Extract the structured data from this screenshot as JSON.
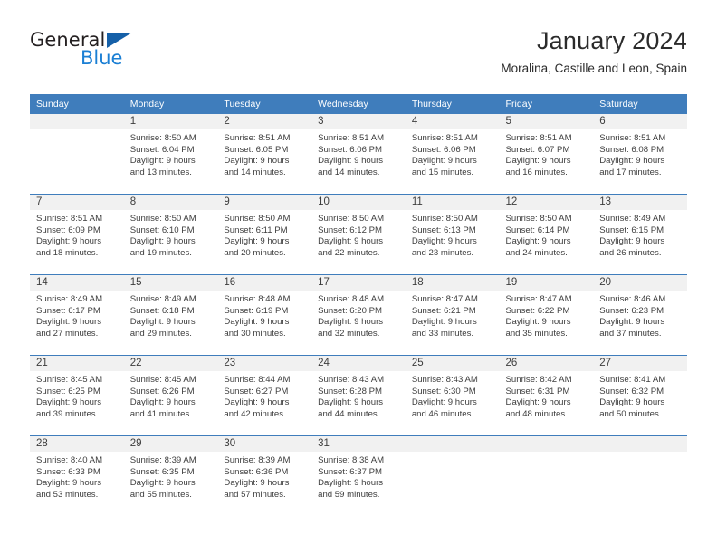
{
  "brand": {
    "name_part1": "General",
    "name_part2": "Blue",
    "triangle_color": "#1560a8",
    "blue_color": "#1b7fd4"
  },
  "header": {
    "title": "January 2024",
    "subtitle": "Moralina, Castille and Leon, Spain"
  },
  "theme": {
    "header_bg": "#3f7dbc",
    "daynum_bg": "#f1f1f1",
    "rule_color": "#3f7dbc",
    "text_color": "#3d3d3d"
  },
  "weekday_headers": [
    "Sunday",
    "Monday",
    "Tuesday",
    "Wednesday",
    "Thursday",
    "Friday",
    "Saturday"
  ],
  "weeks": [
    [
      {
        "day": "",
        "sunrise": "",
        "sunset": "",
        "daylight_line1": "",
        "daylight_line2": ""
      },
      {
        "day": "1",
        "sunrise": "Sunrise: 8:50 AM",
        "sunset": "Sunset: 6:04 PM",
        "daylight_line1": "Daylight: 9 hours",
        "daylight_line2": "and 13 minutes."
      },
      {
        "day": "2",
        "sunrise": "Sunrise: 8:51 AM",
        "sunset": "Sunset: 6:05 PM",
        "daylight_line1": "Daylight: 9 hours",
        "daylight_line2": "and 14 minutes."
      },
      {
        "day": "3",
        "sunrise": "Sunrise: 8:51 AM",
        "sunset": "Sunset: 6:06 PM",
        "daylight_line1": "Daylight: 9 hours",
        "daylight_line2": "and 14 minutes."
      },
      {
        "day": "4",
        "sunrise": "Sunrise: 8:51 AM",
        "sunset": "Sunset: 6:06 PM",
        "daylight_line1": "Daylight: 9 hours",
        "daylight_line2": "and 15 minutes."
      },
      {
        "day": "5",
        "sunrise": "Sunrise: 8:51 AM",
        "sunset": "Sunset: 6:07 PM",
        "daylight_line1": "Daylight: 9 hours",
        "daylight_line2": "and 16 minutes."
      },
      {
        "day": "6",
        "sunrise": "Sunrise: 8:51 AM",
        "sunset": "Sunset: 6:08 PM",
        "daylight_line1": "Daylight: 9 hours",
        "daylight_line2": "and 17 minutes."
      }
    ],
    [
      {
        "day": "7",
        "sunrise": "Sunrise: 8:51 AM",
        "sunset": "Sunset: 6:09 PM",
        "daylight_line1": "Daylight: 9 hours",
        "daylight_line2": "and 18 minutes."
      },
      {
        "day": "8",
        "sunrise": "Sunrise: 8:50 AM",
        "sunset": "Sunset: 6:10 PM",
        "daylight_line1": "Daylight: 9 hours",
        "daylight_line2": "and 19 minutes."
      },
      {
        "day": "9",
        "sunrise": "Sunrise: 8:50 AM",
        "sunset": "Sunset: 6:11 PM",
        "daylight_line1": "Daylight: 9 hours",
        "daylight_line2": "and 20 minutes."
      },
      {
        "day": "10",
        "sunrise": "Sunrise: 8:50 AM",
        "sunset": "Sunset: 6:12 PM",
        "daylight_line1": "Daylight: 9 hours",
        "daylight_line2": "and 22 minutes."
      },
      {
        "day": "11",
        "sunrise": "Sunrise: 8:50 AM",
        "sunset": "Sunset: 6:13 PM",
        "daylight_line1": "Daylight: 9 hours",
        "daylight_line2": "and 23 minutes."
      },
      {
        "day": "12",
        "sunrise": "Sunrise: 8:50 AM",
        "sunset": "Sunset: 6:14 PM",
        "daylight_line1": "Daylight: 9 hours",
        "daylight_line2": "and 24 minutes."
      },
      {
        "day": "13",
        "sunrise": "Sunrise: 8:49 AM",
        "sunset": "Sunset: 6:15 PM",
        "daylight_line1": "Daylight: 9 hours",
        "daylight_line2": "and 26 minutes."
      }
    ],
    [
      {
        "day": "14",
        "sunrise": "Sunrise: 8:49 AM",
        "sunset": "Sunset: 6:17 PM",
        "daylight_line1": "Daylight: 9 hours",
        "daylight_line2": "and 27 minutes."
      },
      {
        "day": "15",
        "sunrise": "Sunrise: 8:49 AM",
        "sunset": "Sunset: 6:18 PM",
        "daylight_line1": "Daylight: 9 hours",
        "daylight_line2": "and 29 minutes."
      },
      {
        "day": "16",
        "sunrise": "Sunrise: 8:48 AM",
        "sunset": "Sunset: 6:19 PM",
        "daylight_line1": "Daylight: 9 hours",
        "daylight_line2": "and 30 minutes."
      },
      {
        "day": "17",
        "sunrise": "Sunrise: 8:48 AM",
        "sunset": "Sunset: 6:20 PM",
        "daylight_line1": "Daylight: 9 hours",
        "daylight_line2": "and 32 minutes."
      },
      {
        "day": "18",
        "sunrise": "Sunrise: 8:47 AM",
        "sunset": "Sunset: 6:21 PM",
        "daylight_line1": "Daylight: 9 hours",
        "daylight_line2": "and 33 minutes."
      },
      {
        "day": "19",
        "sunrise": "Sunrise: 8:47 AM",
        "sunset": "Sunset: 6:22 PM",
        "daylight_line1": "Daylight: 9 hours",
        "daylight_line2": "and 35 minutes."
      },
      {
        "day": "20",
        "sunrise": "Sunrise: 8:46 AM",
        "sunset": "Sunset: 6:23 PM",
        "daylight_line1": "Daylight: 9 hours",
        "daylight_line2": "and 37 minutes."
      }
    ],
    [
      {
        "day": "21",
        "sunrise": "Sunrise: 8:45 AM",
        "sunset": "Sunset: 6:25 PM",
        "daylight_line1": "Daylight: 9 hours",
        "daylight_line2": "and 39 minutes."
      },
      {
        "day": "22",
        "sunrise": "Sunrise: 8:45 AM",
        "sunset": "Sunset: 6:26 PM",
        "daylight_line1": "Daylight: 9 hours",
        "daylight_line2": "and 41 minutes."
      },
      {
        "day": "23",
        "sunrise": "Sunrise: 8:44 AM",
        "sunset": "Sunset: 6:27 PM",
        "daylight_line1": "Daylight: 9 hours",
        "daylight_line2": "and 42 minutes."
      },
      {
        "day": "24",
        "sunrise": "Sunrise: 8:43 AM",
        "sunset": "Sunset: 6:28 PM",
        "daylight_line1": "Daylight: 9 hours",
        "daylight_line2": "and 44 minutes."
      },
      {
        "day": "25",
        "sunrise": "Sunrise: 8:43 AM",
        "sunset": "Sunset: 6:30 PM",
        "daylight_line1": "Daylight: 9 hours",
        "daylight_line2": "and 46 minutes."
      },
      {
        "day": "26",
        "sunrise": "Sunrise: 8:42 AM",
        "sunset": "Sunset: 6:31 PM",
        "daylight_line1": "Daylight: 9 hours",
        "daylight_line2": "and 48 minutes."
      },
      {
        "day": "27",
        "sunrise": "Sunrise: 8:41 AM",
        "sunset": "Sunset: 6:32 PM",
        "daylight_line1": "Daylight: 9 hours",
        "daylight_line2": "and 50 minutes."
      }
    ],
    [
      {
        "day": "28",
        "sunrise": "Sunrise: 8:40 AM",
        "sunset": "Sunset: 6:33 PM",
        "daylight_line1": "Daylight: 9 hours",
        "daylight_line2": "and 53 minutes."
      },
      {
        "day": "29",
        "sunrise": "Sunrise: 8:39 AM",
        "sunset": "Sunset: 6:35 PM",
        "daylight_line1": "Daylight: 9 hours",
        "daylight_line2": "and 55 minutes."
      },
      {
        "day": "30",
        "sunrise": "Sunrise: 8:39 AM",
        "sunset": "Sunset: 6:36 PM",
        "daylight_line1": "Daylight: 9 hours",
        "daylight_line2": "and 57 minutes."
      },
      {
        "day": "31",
        "sunrise": "Sunrise: 8:38 AM",
        "sunset": "Sunset: 6:37 PM",
        "daylight_line1": "Daylight: 9 hours",
        "daylight_line2": "and 59 minutes."
      },
      {
        "day": "",
        "sunrise": "",
        "sunset": "",
        "daylight_line1": "",
        "daylight_line2": ""
      },
      {
        "day": "",
        "sunrise": "",
        "sunset": "",
        "daylight_line1": "",
        "daylight_line2": ""
      },
      {
        "day": "",
        "sunrise": "",
        "sunset": "",
        "daylight_line1": "",
        "daylight_line2": ""
      }
    ]
  ]
}
